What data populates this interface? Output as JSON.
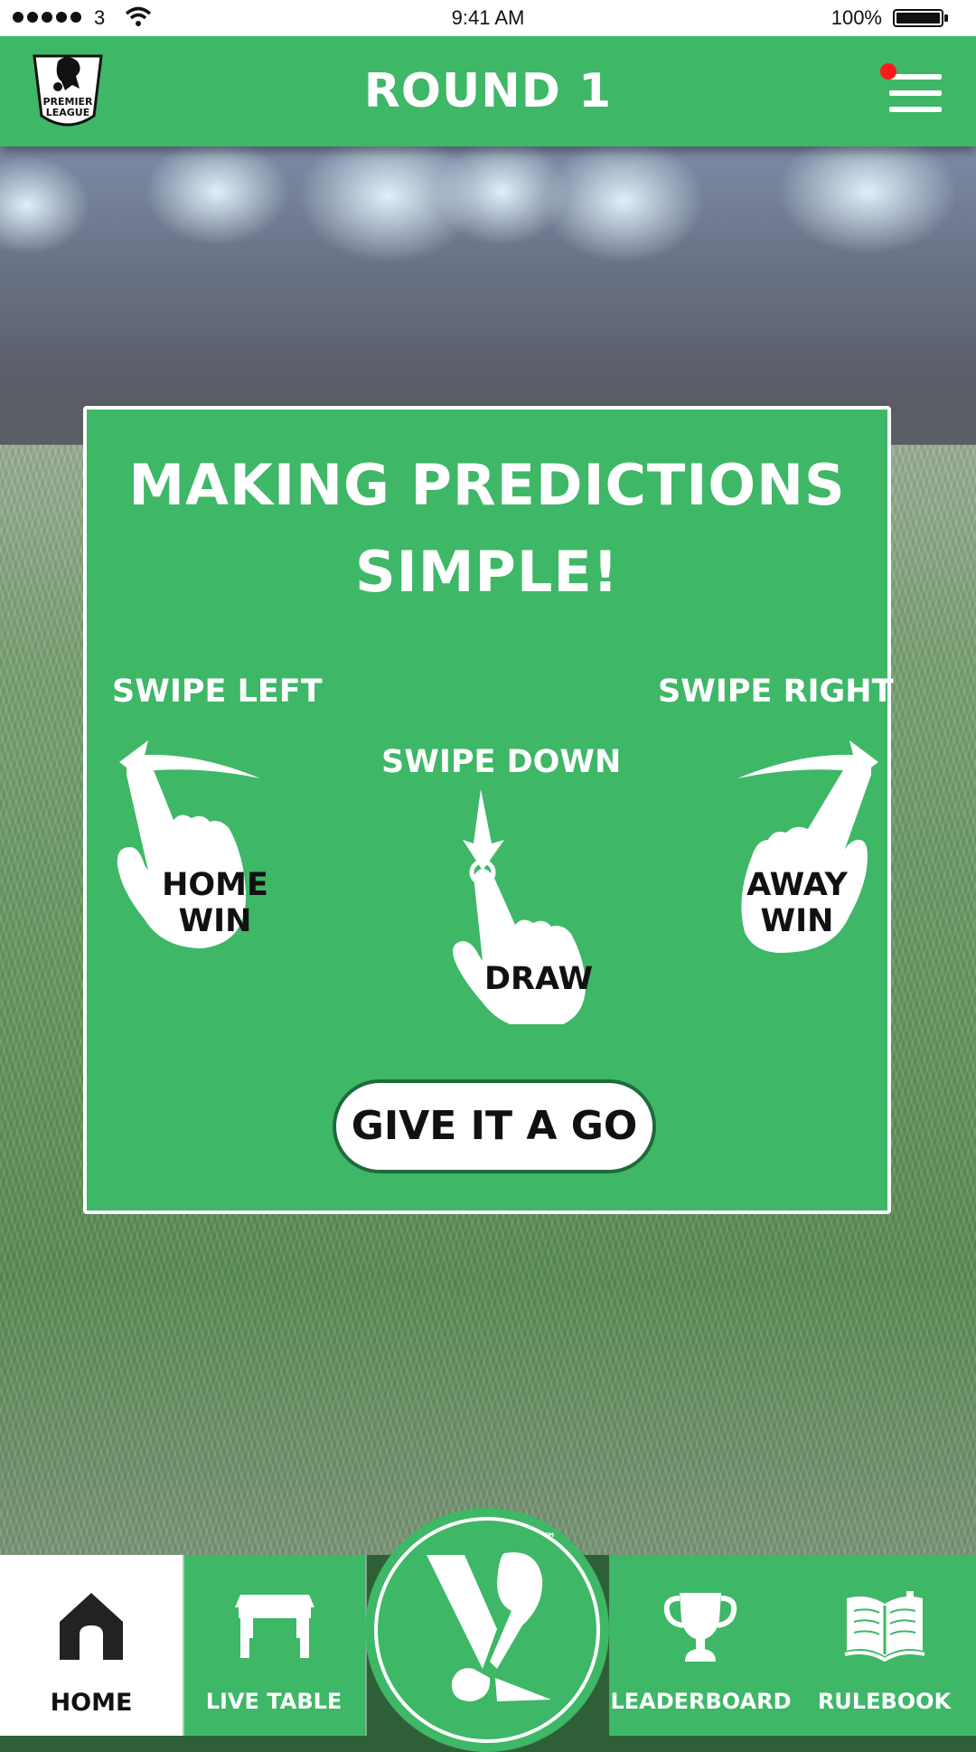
{
  "status_bar": {
    "carrier": "3",
    "time": "9:41 AM",
    "battery": "100%"
  },
  "header": {
    "title": "ROUND 1",
    "logo_text_line1": "PREMIER",
    "logo_text_line2": "LEAGUE"
  },
  "card": {
    "title_line1": "MAKING PREDICTIONS",
    "title_line2": "SIMPLE!",
    "swipe_left_label": "SWIPE LEFT",
    "swipe_down_label": "SWIPE DOWN",
    "swipe_right_label": "SWIPE RIGHT",
    "home_win_line1": "HOME",
    "home_win_line2": "WIN",
    "draw_label": "DRAW",
    "away_win_line1": "AWAY",
    "away_win_line2": "WIN",
    "button_label": "GIVE IT A GO"
  },
  "bottom_nav": {
    "home": "HOME",
    "live_table": "LIVE TABLE",
    "center_tm": "™",
    "leaderboard": "LEADERBOARD",
    "rulebook": "RULEBOOK"
  },
  "colors": {
    "brand_green": "#3eb767",
    "dark_green": "#1f6a3d",
    "notification_red": "#ff1a1a",
    "white": "#ffffff"
  },
  "icons": [
    "premier-league-logo",
    "menu-icon",
    "hand-swipe-left-icon",
    "hand-swipe-down-icon",
    "hand-swipe-right-icon",
    "home-icon",
    "table-icon",
    "app-logo-icon",
    "trophy-icon",
    "book-icon"
  ]
}
